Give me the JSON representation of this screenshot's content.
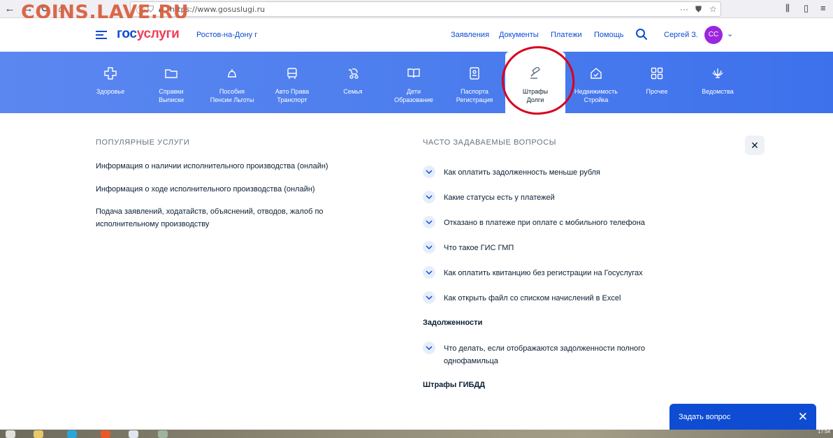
{
  "browser": {
    "url": "https://www.gosuslugi.ru",
    "watermark": "COINS.LAVE.RU"
  },
  "header": {
    "logo_part1": "гос",
    "logo_part2": "услуги",
    "region": "Ростов-на-Дону г",
    "links": [
      "Заявления",
      "Документы",
      "Платежи",
      "Помощь"
    ],
    "user_name": "Сергей З.",
    "avatar_initials": "СС"
  },
  "categories": [
    {
      "label": "Здоровье",
      "icon": "plus-icon"
    },
    {
      "label": "Справки\nВыписки",
      "icon": "folder-icon"
    },
    {
      "label": "Пособия\nПенсии Льготы",
      "icon": "bell-icon"
    },
    {
      "label": "Авто Права\nТранспорт",
      "icon": "car-icon"
    },
    {
      "label": "Семья",
      "icon": "stroller-icon"
    },
    {
      "label": "Дети\nОбразование",
      "icon": "book-icon"
    },
    {
      "label": "Паспорта\nРегистрация",
      "icon": "passport-icon"
    },
    {
      "label": "Штрафы\nДолги",
      "icon": "gavel-icon"
    },
    {
      "label": "Недвижимость\nСтройка",
      "icon": "house-icon"
    },
    {
      "label": "Прочее",
      "icon": "grid-icon"
    },
    {
      "label": "Ведомства",
      "icon": "eagle-icon"
    }
  ],
  "popular": {
    "title": "ПОПУЛЯРНЫЕ УСЛУГИ",
    "items": [
      "Информация о наличии исполнительного производства (онлайн)",
      "Информация о ходе исполнительного производства (онлайн)",
      "Подача заявлений, ходатайств, объяснений, отводов, жалоб по исполнительному производству"
    ]
  },
  "faq": {
    "title": "ЧАСТО ЗАДАВАЕМЫЕ ВОПРОСЫ",
    "items": [
      "Как оплатить задолженность меньше рубля",
      "Какие статусы есть у платежей",
      "Отказано в платеже при оплате с мобильного телефона",
      "Что такое ГИС ГМП",
      "Как оплатить квитанцию без регистрации на Госуслугах",
      "Как открыть файл со списком начислений в Excel"
    ],
    "subhead1": "Задолженности",
    "items2": [
      "Что делать, если отображаются задолженности полного однофамильца"
    ],
    "subhead2": "Штрафы ГИБДД"
  },
  "ask": {
    "label": "Задать вопрос"
  },
  "taskbar": {
    "clock": "17:54"
  },
  "colors": {
    "brand_blue": "#0d4cd3",
    "brand_red": "#ee3f58",
    "annotation_red": "#d8001e",
    "avatar_purple": "#9c26dd"
  }
}
